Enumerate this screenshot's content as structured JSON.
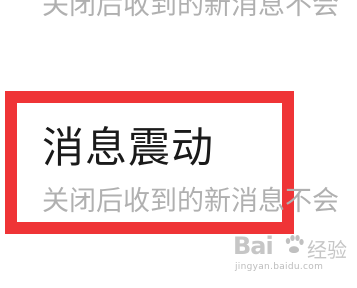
{
  "top_item": {
    "description": "关闭后收到的新消息不会"
  },
  "vibration_item": {
    "title": "消息震动",
    "description": "关闭后收到的新消息不会"
  },
  "highlight": {
    "color": "#ef3436"
  },
  "watermark": {
    "logo_text": "Bai",
    "icon": "paw-icon",
    "suffix": "经验",
    "url": "jingyan.baidu.com"
  }
}
